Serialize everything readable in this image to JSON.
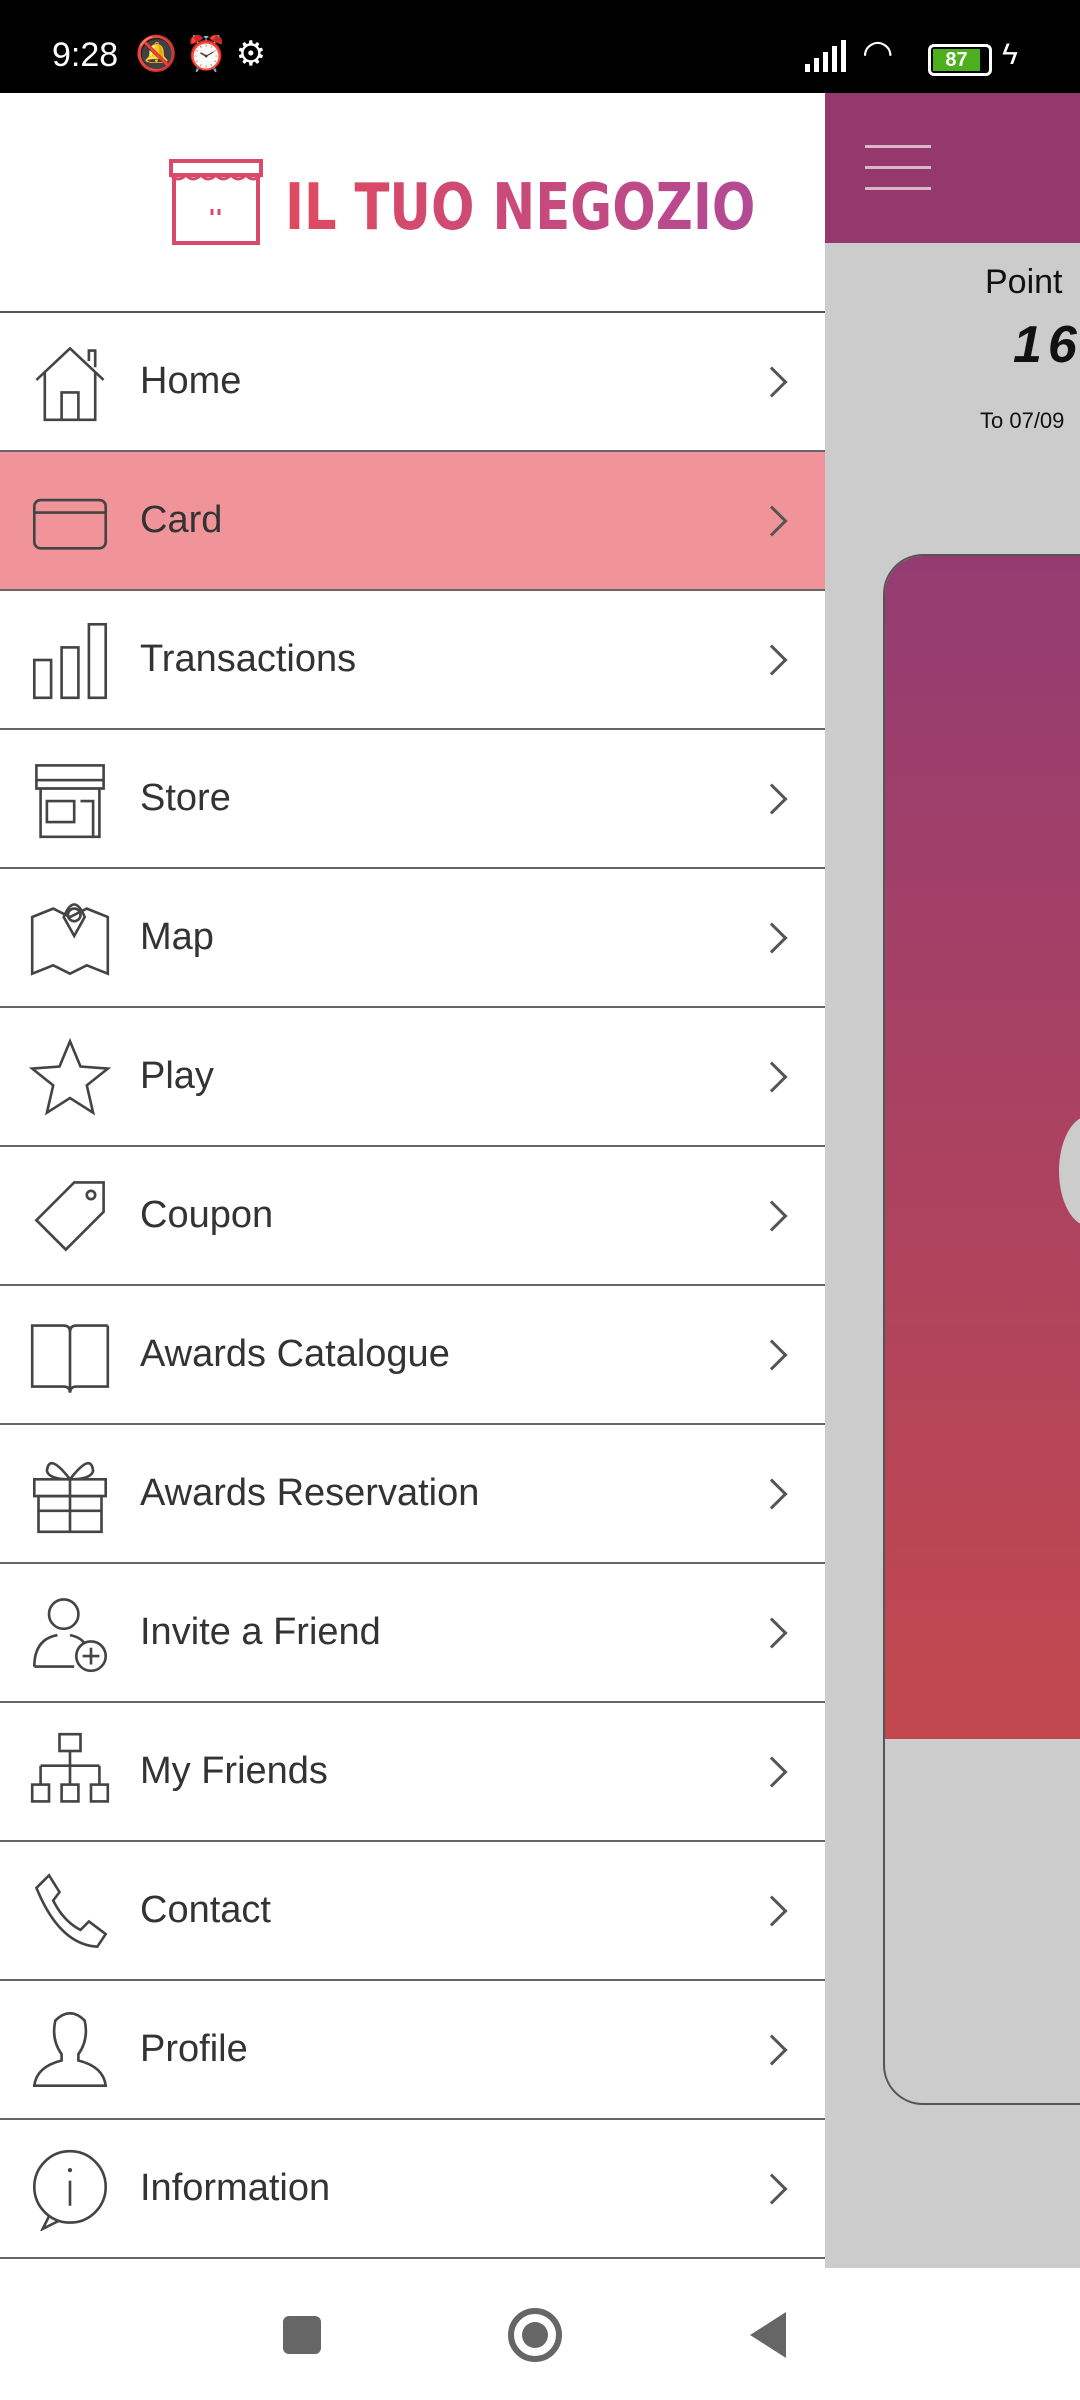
{
  "status_bar": {
    "time": "9:28",
    "battery": "87",
    "icons": [
      "mute-icon",
      "alarm-icon",
      "android-debug-icon",
      "signal-icon",
      "wifi-icon",
      "battery-icon",
      "charging-icon"
    ]
  },
  "drawer": {
    "logo_text": "IL TUO NEGOZIO",
    "active_color": "#f09499",
    "items": [
      {
        "label": "Home",
        "icon": "home-icon"
      },
      {
        "label": "Card",
        "icon": "credit-card-icon",
        "active": true
      },
      {
        "label": "Transactions",
        "icon": "bar-chart-icon"
      },
      {
        "label": "Store",
        "icon": "store-icon"
      },
      {
        "label": "Map",
        "icon": "map-pin-icon"
      },
      {
        "label": "Play",
        "icon": "star-icon"
      },
      {
        "label": "Coupon",
        "icon": "tag-icon"
      },
      {
        "label": "Awards Catalogue",
        "icon": "book-icon"
      },
      {
        "label": "Awards Reservation",
        "icon": "gift-icon"
      },
      {
        "label": "Invite a Friend",
        "icon": "user-add-icon"
      },
      {
        "label": "My Friends",
        "icon": "hierarchy-icon"
      },
      {
        "label": "Contact",
        "icon": "phone-icon"
      },
      {
        "label": "Profile",
        "icon": "user-icon"
      },
      {
        "label": "Information",
        "icon": "info-icon"
      }
    ]
  },
  "main": {
    "point_label": "Point",
    "point_value": "16",
    "date_text": "To 07/09",
    "header_color": "#94386d"
  }
}
